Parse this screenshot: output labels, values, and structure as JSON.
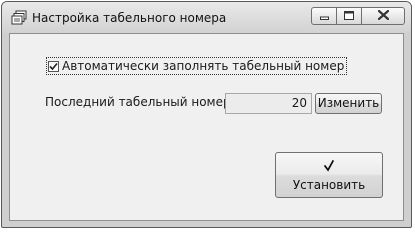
{
  "window": {
    "title": "Настройка табельного номера",
    "icon": "stack-of-cards-icon",
    "controls": [
      "minimize-icon",
      "maximize-icon",
      "close-icon"
    ]
  },
  "form": {
    "auto_fill": {
      "label": "Автоматически заполнять табельный номер",
      "checked": true
    },
    "last_number": {
      "label": "Последний табельный номер",
      "value": "20"
    },
    "change_button": "Изменить",
    "install_button": {
      "label": "Установить",
      "icon": "checkmark-icon"
    }
  }
}
